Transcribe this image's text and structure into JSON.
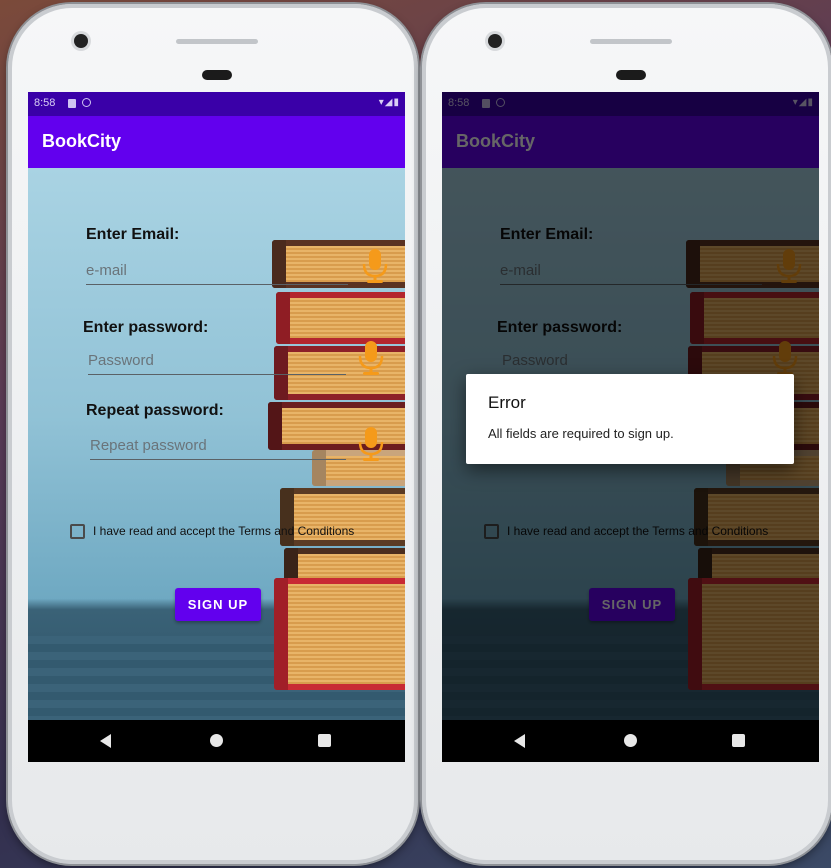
{
  "status": {
    "time": "8:58",
    "icons": "▾◢▮"
  },
  "app": {
    "title": "BookCity"
  },
  "form": {
    "email_label": "Enter Email:",
    "email_placeholder": "e-mail",
    "password_label": "Enter password:",
    "password_placeholder": "Password",
    "repeat_label": "Repeat password:",
    "repeat_placeholder": "Repeat password",
    "terms_text": "I have read and accept the Terms and Conditions",
    "signup_label": "SIGN UP"
  },
  "dialog": {
    "title": "Error",
    "message": "All fields are required to sign up."
  },
  "colors": {
    "primary": "#6200ee",
    "primary_dark": "#3a00a8",
    "mic": "#f59a1a"
  },
  "icons": {
    "mic": "microphone-icon",
    "back": "back-icon",
    "home": "home-icon",
    "recents": "recents-icon"
  }
}
